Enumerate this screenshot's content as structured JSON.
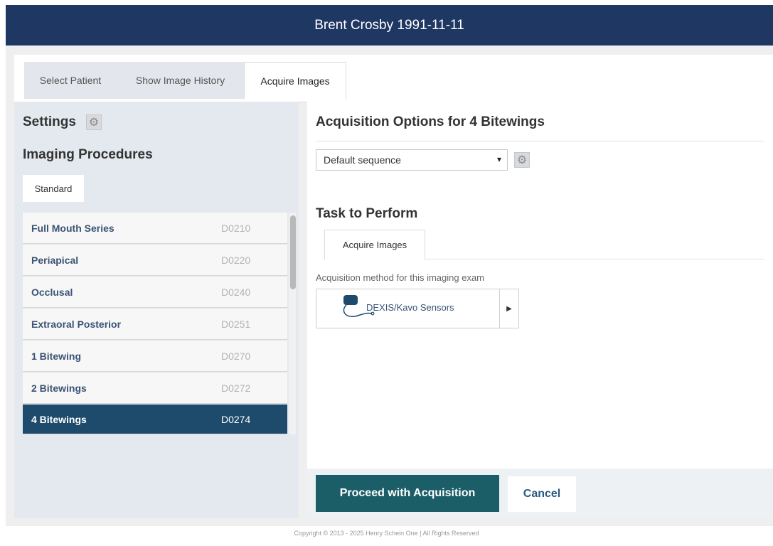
{
  "header": {
    "title": "Brent Crosby 1991-11-11"
  },
  "tabs": [
    {
      "label": "Select Patient"
    },
    {
      "label": "Show Image History"
    },
    {
      "label": "Acquire Images"
    }
  ],
  "left": {
    "settings_label": "Settings",
    "procedures_heading": "Imaging Procedures",
    "category_tab": "Standard",
    "procedures": [
      {
        "name": "Full Mouth Series",
        "code": "D0210"
      },
      {
        "name": "Periapical",
        "code": "D0220"
      },
      {
        "name": "Occlusal",
        "code": "D0240"
      },
      {
        "name": "Extraoral Posterior",
        "code": "D0251"
      },
      {
        "name": "1 Bitewing",
        "code": "D0270"
      },
      {
        "name": "2 Bitewings",
        "code": "D0272"
      },
      {
        "name": "4 Bitewings",
        "code": "D0274"
      }
    ],
    "selected_procedure": "4 Bitewings"
  },
  "right": {
    "options_heading": "Acquisition Options for 4 Bitewings",
    "sequence_value": "Default sequence",
    "task_heading": "Task to Perform",
    "task_tab": "Acquire Images",
    "method_hint": "Acquisition method for this imaging exam",
    "method_label": "DEXIS/Kavo Sensors"
  },
  "actions": {
    "proceed_label": "Proceed with Acquisition",
    "cancel_label": "Cancel"
  },
  "footer": {
    "copyright": "Copyright © 2013 - 2025 Henry Schein One | All Rights Reserved"
  },
  "colors": {
    "header_bg": "#1f3763",
    "selected_row": "#1e4a6b",
    "primary_button": "#1c5e67"
  },
  "icons": [
    "gear-icon",
    "chevron-down-icon",
    "sensor-icon",
    "caret-right-icon"
  ]
}
